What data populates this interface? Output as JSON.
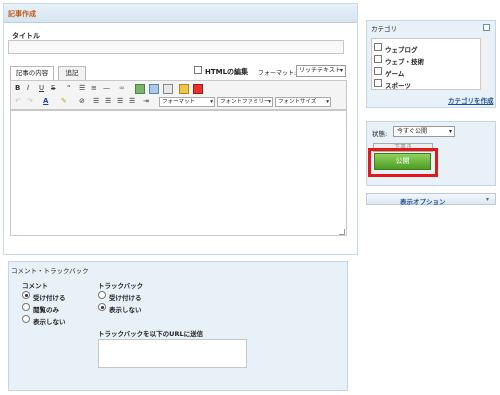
{
  "main": {
    "header_title": "記事作成",
    "title_label": "タイトル",
    "tabs": [
      "記事の内容",
      "追記"
    ],
    "html_edit_label": "HTMLの編集",
    "format_label": "フォーマット:",
    "format_value": "リッチテキスト",
    "toolbar": {
      "bold": "B",
      "italic": "I",
      "underline": "U",
      "strike": "S",
      "format_select": "フォーマット",
      "font_family_select": "フォントファミリー",
      "font_size_select": "フォントサイズ"
    }
  },
  "comments": {
    "section_title": "コメント・トラックバック",
    "comment_heading": "コメント",
    "comment_options": [
      "受け付ける",
      "閲覧のみ",
      "表示しない"
    ],
    "comment_selected": 0,
    "trackback_heading": "トラックバック",
    "trackback_options": [
      "受け付ける",
      "表示しない"
    ],
    "trackback_selected": 1,
    "trackback_url_label": "トラックバックを以下のURLに送信"
  },
  "category": {
    "title": "カテゴリ",
    "items": [
      "ウェブログ",
      "ウェブ・技術",
      "ゲーム",
      "スポーツ"
    ],
    "create_link": "カテゴリを作成"
  },
  "status": {
    "label": "状態:",
    "value": "今すぐ公開",
    "draft_button": "下書き",
    "publish_button": "公開"
  },
  "display_options": {
    "label": "表示オプション"
  },
  "colors": {
    "header_text": "#c25a1b",
    "panel_bg": "#e8f1f8",
    "highlight": "#e01a1a",
    "publish_green": "#5aa82d",
    "link": "#1f4f98"
  }
}
